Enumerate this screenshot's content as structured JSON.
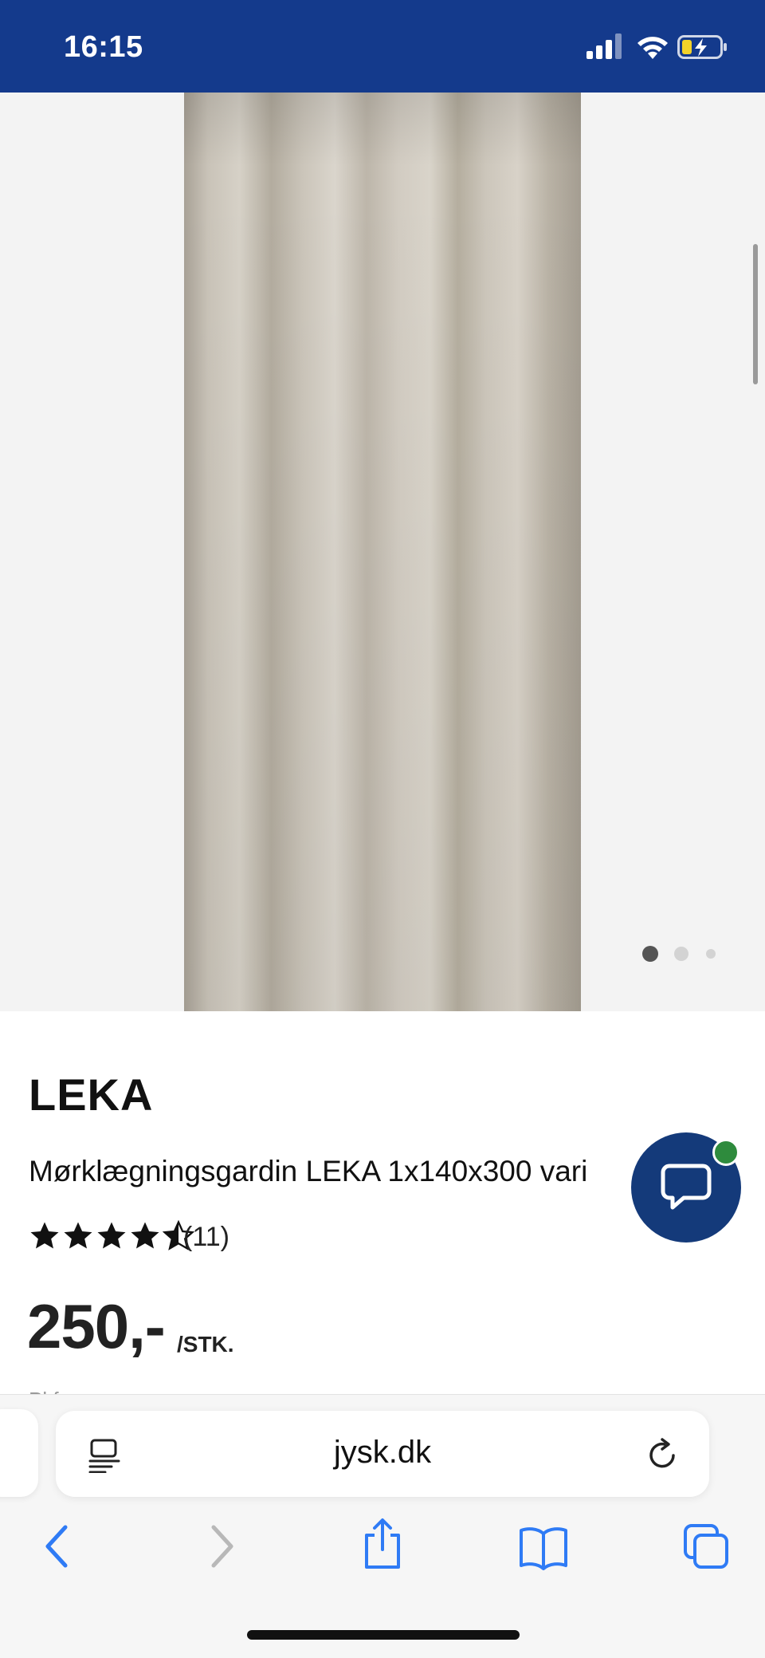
{
  "status_bar": {
    "time": "16:15",
    "background": "#143a8c",
    "icons": [
      "signal-icon",
      "wifi-icon",
      "battery-charging-icon"
    ]
  },
  "gallery": {
    "image": "beige blackout curtain",
    "page_count": 3,
    "active_page": 1
  },
  "product": {
    "brand": "LEKA",
    "name": "Mørklægningsgardin LEKA 1x140x300 vari",
    "rating": 4.5,
    "rating_max": 5,
    "review_count": "(11)",
    "price": "250,-",
    "price_unit": "/STK.",
    "cutoff_text": "Pl           f"
  },
  "chat": {
    "icon": "chat-bubble-icon",
    "status_color": "#2e8b3d",
    "background": "#143a7a"
  },
  "browser": {
    "url": "jysk.dk",
    "accent": "#2f7bf5",
    "toolbar": [
      "back-icon",
      "forward-icon",
      "share-icon",
      "bookmarks-icon",
      "tabs-icon"
    ]
  }
}
